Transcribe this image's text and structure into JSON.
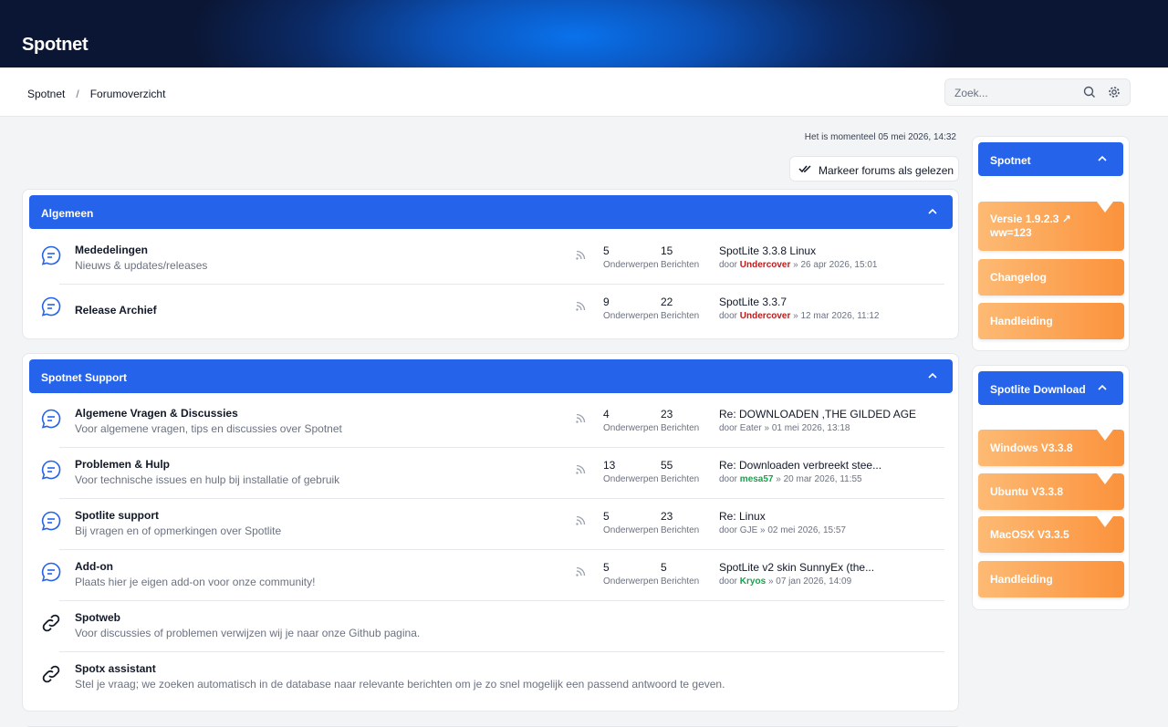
{
  "header": {
    "brand": "Spotnet"
  },
  "breadcrumb": {
    "home": "Spotnet",
    "current": "Forumoverzicht"
  },
  "search": {
    "placeholder": "Zoek..."
  },
  "clock": "Het is momenteel 05 mei 2026, 14:32",
  "mark_read": "Markeer forums als gelezen",
  "labels": {
    "topics": "Onderwerpen",
    "posts": "Berichten",
    "by": "door"
  },
  "categories": [
    {
      "name": "Algemeen",
      "forums": [
        {
          "title": "Mededelingen",
          "desc": "Nieuws & updates/releases",
          "topics": "5",
          "posts": "15",
          "last_title": "SpotLite 3.3.8 Linux",
          "last_user": "Undercover",
          "last_date": "» 26 apr 2026, 15:01"
        },
        {
          "title": "Release Archief",
          "desc": "",
          "topics": "9",
          "posts": "22",
          "last_title": "SpotLite 3.3.7",
          "last_user": "Undercover",
          "last_date": "» 12 mar 2026, 11:12"
        }
      ]
    },
    {
      "name": "Spotnet Support",
      "forums": [
        {
          "title": "Algemene Vragen & Discussies",
          "desc": "Voor algemene vragen, tips en discussies over Spotnet",
          "topics": "4",
          "posts": "23",
          "last_title": "Re: DOWNLOADEN ,THE GILDED AGE",
          "last_user": "Eater",
          "last_date": "» 01 mei 2026, 13:18"
        },
        {
          "title": "Problemen & Hulp",
          "desc": "Voor technische issues en hulp bij installatie of gebruik",
          "topics": "13",
          "posts": "55",
          "last_title": "Re: Downloaden verbreekt stee...",
          "last_user": "mesa57",
          "last_date": "» 20 mar 2026, 11:55"
        },
        {
          "title": "Spotlite support",
          "desc": "Bij vragen en of opmerkingen over Spotlite",
          "topics": "5",
          "posts": "23",
          "last_title": "Re: Linux",
          "last_user": "GJE",
          "last_date": "» 02 mei 2026, 15:57"
        },
        {
          "title": "Add-on",
          "desc": "Plaats hier je eigen add-on voor onze community!",
          "topics": "5",
          "posts": "5",
          "last_title": "SpotLite v2 skin SunnyEx (the...",
          "last_user": "Kryos",
          "last_date": "» 07 jan 2026, 14:09"
        },
        {
          "title": "Spotweb",
          "desc": "Voor discussies of problemen verwijzen wij je naar onze Github pagina."
        },
        {
          "title": "Spotx assistant",
          "desc": "Stel je vraag; we zoeken automatisch in de database naar relevante berichten om je zo snel mogelijk een passend antwoord te geven."
        }
      ]
    }
  ],
  "sidebar": {
    "spotnet": {
      "title": "Spotnet",
      "version_line1": "Versie 1.9.2.3 ↗",
      "version_line2": "ww=123",
      "changelog": "Changelog",
      "manual": "Handleiding"
    },
    "download": {
      "title": "Spotlite Download",
      "windows": "Windows V3.3.8",
      "ubuntu": "Ubuntu V3.3.8",
      "macos": "MacOSX V3.3.5",
      "manual": "Handleiding"
    }
  },
  "colors": {
    "accent": "#2563eb",
    "orange": "#fb923c",
    "user_red": "#b91c1c",
    "user_green": "#16a34a"
  }
}
